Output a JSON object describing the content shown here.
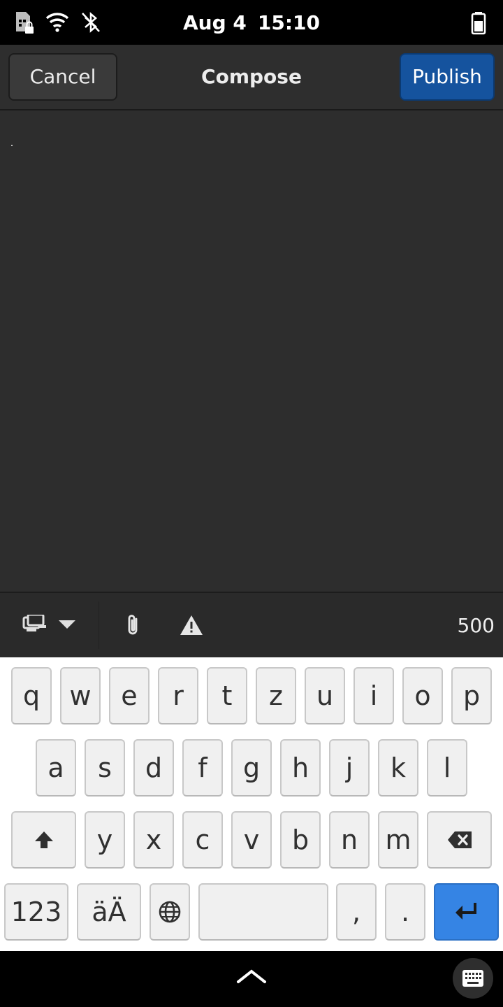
{
  "status": {
    "date": "Aug 4",
    "time": "15:10",
    "icons": [
      "sim-locked-icon",
      "wifi-icon",
      "bluetooth-disabled-icon",
      "battery-icon"
    ]
  },
  "header": {
    "cancel_label": "Cancel",
    "title": "Compose",
    "publish_label": "Publish"
  },
  "compose": {
    "text": ""
  },
  "toolbar": {
    "icons": [
      "visibility-icon",
      "dropdown-arrow-icon",
      "attachment-icon",
      "content-warning-icon"
    ],
    "char_count": "500"
  },
  "keyboard": {
    "row1": [
      "q",
      "w",
      "e",
      "r",
      "t",
      "z",
      "u",
      "i",
      "o",
      "p"
    ],
    "row2": [
      "a",
      "s",
      "d",
      "f",
      "g",
      "h",
      "j",
      "k",
      "l"
    ],
    "row3": [
      "y",
      "x",
      "c",
      "v",
      "b",
      "n",
      "m"
    ],
    "row4": {
      "numbers": "123",
      "umlaut": "äÄ",
      "comma": ",",
      "period": "."
    },
    "accent_color": "#3584e4"
  },
  "bottom": {
    "icons": [
      "chevron-up-icon",
      "keyboard-icon"
    ]
  }
}
